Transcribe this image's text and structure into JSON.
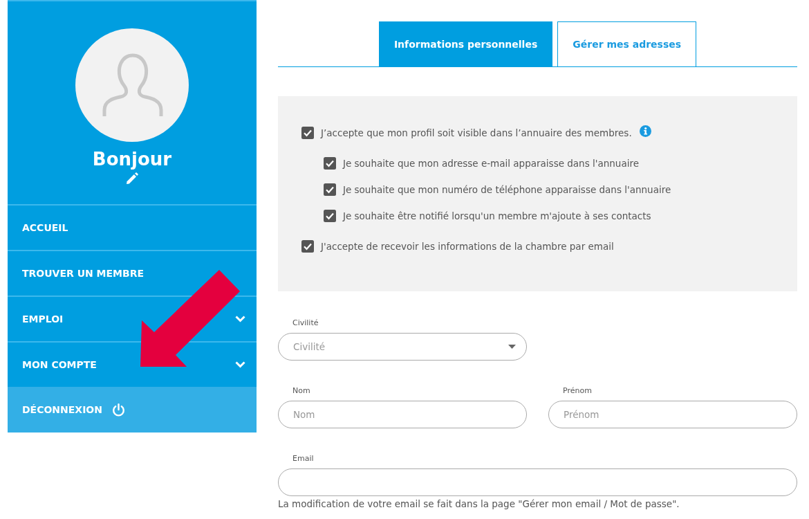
{
  "sidebar": {
    "greeting": "Bonjour",
    "menu": [
      {
        "label": "ACCUEIL",
        "kind": "link"
      },
      {
        "label": "TROUVER UN MEMBRE",
        "kind": "link"
      },
      {
        "label": "EMPLOI",
        "kind": "submenu",
        "expanded": false
      },
      {
        "label": "MON COMPTE",
        "kind": "submenu",
        "expanded": false
      },
      {
        "label": "DÉCONNEXION",
        "kind": "logout"
      }
    ]
  },
  "tabs": [
    {
      "label": "Informations personnelles",
      "selected": true
    },
    {
      "label": "Gérer mes adresses",
      "selected": false
    }
  ],
  "preferences": [
    {
      "label": "J’accepte que mon profil soit visible dans l’annuaire des membres.",
      "checked": true,
      "info": true,
      "children": [
        {
          "label": "Je souhaite que mon adresse e-mail apparaisse dans l'annuaire",
          "checked": true
        },
        {
          "label": "Je souhaite que mon numéro de téléphone apparaisse dans l'annuaire",
          "checked": true
        },
        {
          "label": "Je souhaite être notifié lorsqu'un membre m'ajoute à ses contacts",
          "checked": true
        }
      ]
    },
    {
      "label": "J'accepte de recevoir les informations de la chambre par email",
      "checked": true
    }
  ],
  "form": {
    "rows": [
      {
        "fields": [
          {
            "kind": "select",
            "label": "Civilité",
            "placeholder": "Civilité"
          }
        ]
      },
      {
        "fields": [
          {
            "kind": "text",
            "label": "Nom",
            "placeholder": "Nom"
          },
          {
            "kind": "text",
            "label": "Prénom",
            "placeholder": "Prénom"
          }
        ]
      },
      {
        "fields": [
          {
            "kind": "email",
            "label": "Email",
            "help": "La modification de votre email se fait dans la page \"Gérer mon email / Mot de passe\"."
          }
        ]
      }
    ]
  }
}
